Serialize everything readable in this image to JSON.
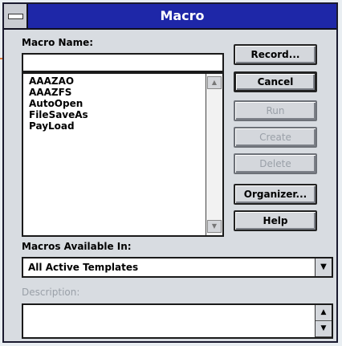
{
  "window": {
    "title": "Macro"
  },
  "macro_name": {
    "label": "Macro Name:",
    "value": ""
  },
  "macro_list": {
    "items": [
      "AAAZAO",
      "AAAZFS",
      "AutoOpen",
      "FileSaveAs",
      "PayLoad"
    ]
  },
  "buttons": {
    "record": "Record...",
    "cancel": "Cancel",
    "run": "Run",
    "create": "Create",
    "delete": "Delete",
    "organizer": "Organizer...",
    "help": "Help"
  },
  "macros_available": {
    "label": "Macros Available In:",
    "value": "All Active Templates"
  },
  "description": {
    "label": "Description:",
    "value": ""
  },
  "icons": {
    "scroll_up": "arrow-up-icon",
    "scroll_down": "arrow-down-icon",
    "dropdown": "dropdown-arrow-icon"
  }
}
